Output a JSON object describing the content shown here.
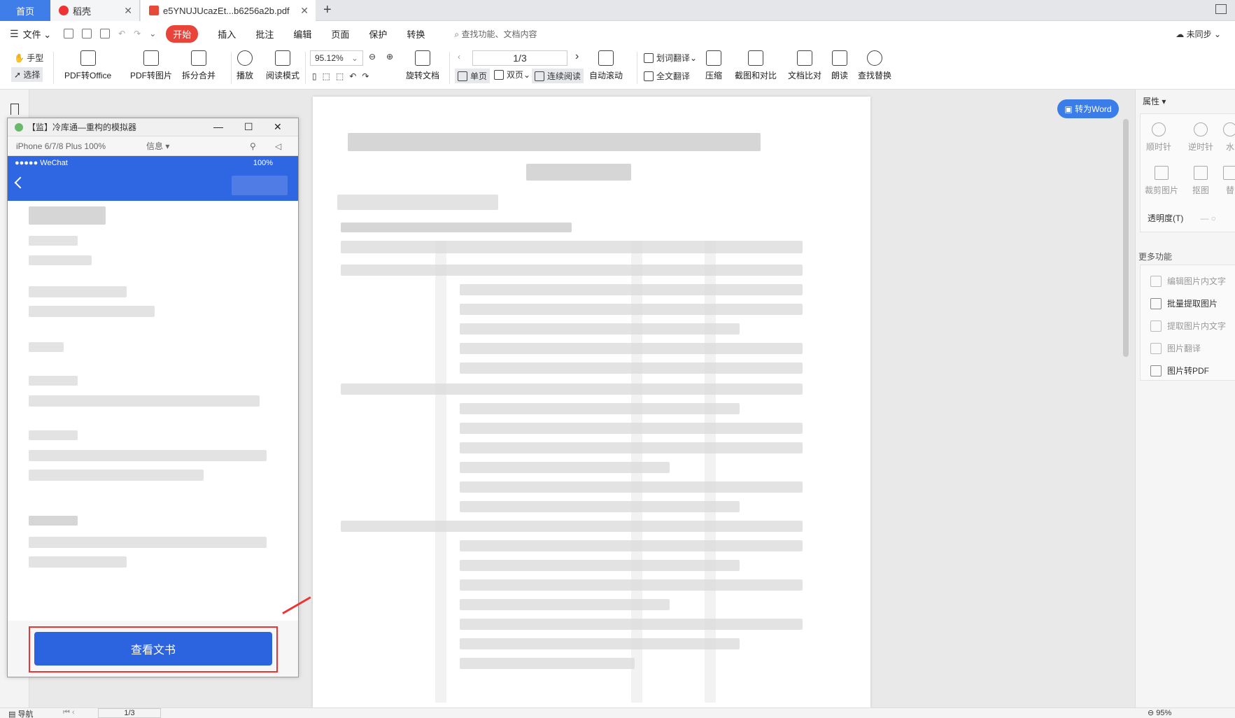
{
  "tabs": {
    "home": "首页",
    "doc1": "稻壳",
    "doc2": "e5YNUJUcazEt...b6256a2b.pdf"
  },
  "menu": {
    "file": "文件",
    "items": [
      "开始",
      "插入",
      "批注",
      "编辑",
      "页面",
      "保护",
      "转换"
    ],
    "search_placeholder": "查找功能、文档内容",
    "sync": "未同步"
  },
  "toolbar": {
    "hand": "手型",
    "select": "选择",
    "pdf_to_office": "PDF转Office",
    "pdf_to_image": "PDF转图片",
    "split_merge": "拆分合并",
    "play": "播放",
    "read_mode": "阅读模式",
    "zoom": "95.12%",
    "rotate_doc": "旋转文档",
    "page": "1/3",
    "single_page": "单页",
    "double_page": "双页",
    "continuous": "连续阅读",
    "auto_scroll": "自动滚动",
    "word_translate": "划词翻译",
    "full_translate": "全文翻译",
    "compress": "压缩",
    "screenshot_compare": "截图和对比",
    "doc_compare": "文档比对",
    "read_aloud": "朗读",
    "find_replace": "查找替换"
  },
  "convert_button": "转为Word",
  "simulator": {
    "title": "【监】冷库通—重构的模拟器",
    "device": "iPhone 6/7/8 Plus 100%",
    "info": "信息",
    "status_left": "●●●●● WeChat",
    "status_right": "100%",
    "view_button": "查看文书"
  },
  "properties": {
    "title": "属性",
    "rotate_cw": "顺时针",
    "rotate_ccw": "逆时针",
    "water": "水",
    "crop": "裁剪图片",
    "cutout": "抠图",
    "replace": "替",
    "opacity": "透明度(T)",
    "more": "更多功能",
    "features": [
      {
        "label": "编辑图片内文字",
        "enabled": false
      },
      {
        "label": "批量提取图片",
        "enabled": true
      },
      {
        "label": "提取图片内文字",
        "enabled": false
      },
      {
        "label": "图片翻译",
        "enabled": false
      },
      {
        "label": "图片转PDF",
        "enabled": true
      }
    ]
  },
  "status": {
    "nav": "导航",
    "page": "1/3",
    "zoom": "95%"
  }
}
